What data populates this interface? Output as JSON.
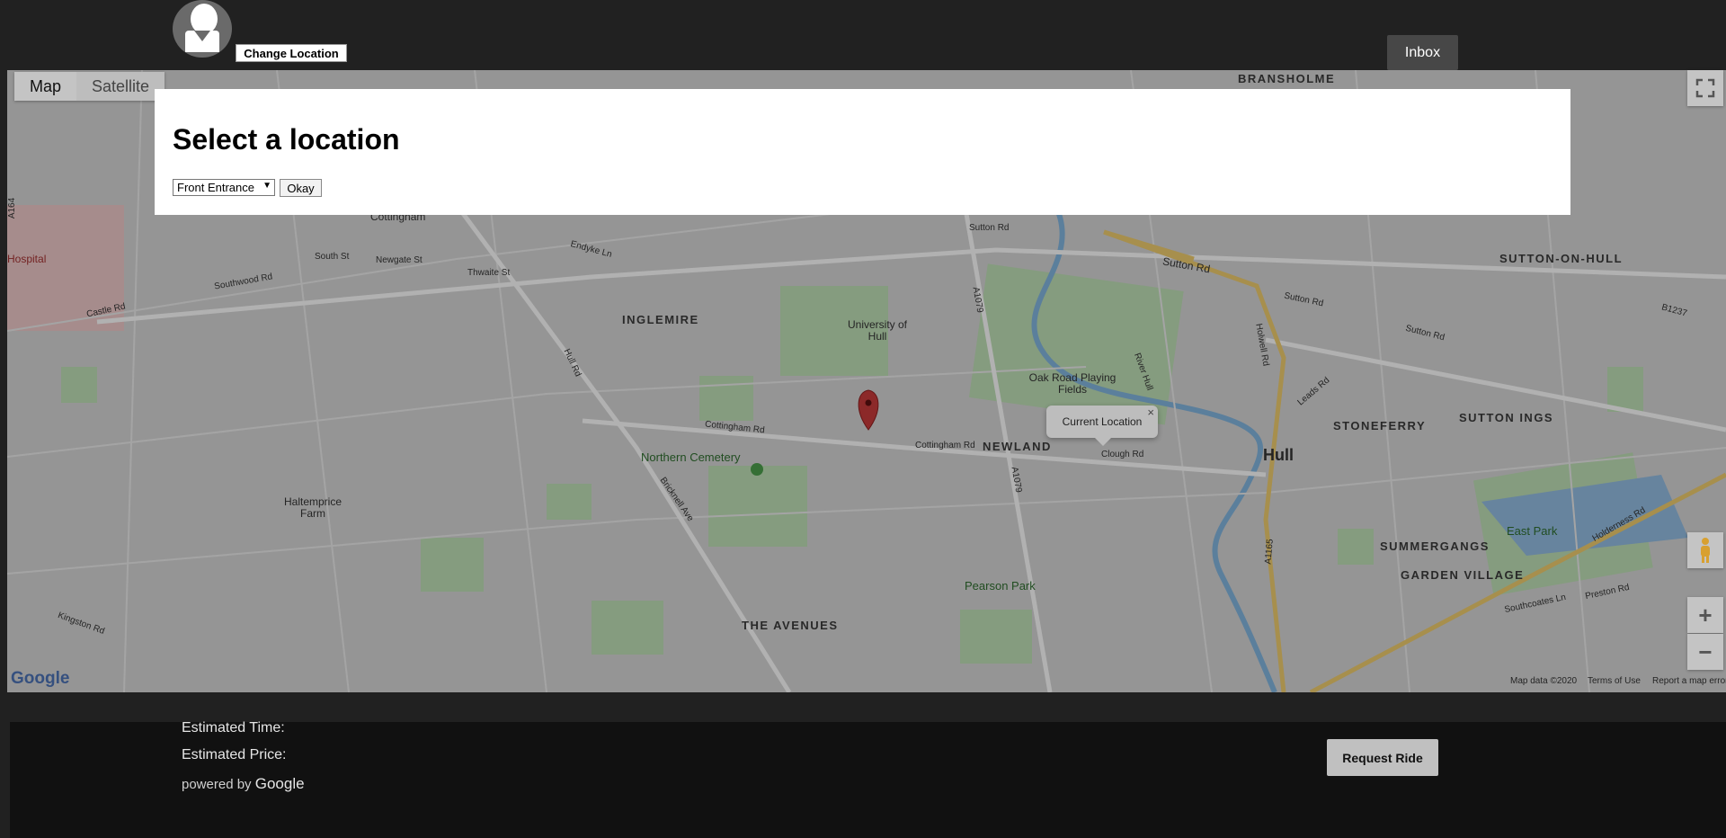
{
  "header": {
    "change_location_label": "Change Location",
    "inbox_label": "Inbox"
  },
  "map": {
    "type_buttons": [
      "Map",
      "Satellite"
    ],
    "labels": {
      "bransholme": "BRANSHOLME",
      "cottingham": "Cottingham",
      "hospital": "Hospital",
      "south_st": "South St",
      "newgate_st": "Newgate St",
      "thwaite_st": "Thwaite St",
      "endyke_ln": "Endyke Ln",
      "southwood_rd": "Southwood Rd",
      "castle_rd": "Castle Rd",
      "inglemire": "INGLEMIRE",
      "university": "University of Hull",
      "hull_rd": "Hull Rd",
      "a164": "A164",
      "sutton_rd_1": "Sutton Rd",
      "sutton_rd_2": "Sutton Rd",
      "sutton_rd_3": "Sutton Rd",
      "sutton_rd_4": "Sutton Rd",
      "sutton_on_hull": "SUTTON-ON-HULL",
      "oak_road": "Oak Road Playing Fields",
      "river_hull": "River Hull",
      "a1079_1": "A1079",
      "a1079_2": "A1079",
      "holwell_rd": "Holwell Rd",
      "leads_rd": "Leads Rd",
      "stoneferry": "STONEFERRY",
      "sutton_ings": "SUTTON INGS",
      "cottingham_rd_1": "Cottingham Rd",
      "cottingham_rd_2": "Cottingham Rd",
      "newland": "NEWLAND",
      "clough_rd": "Clough Rd",
      "hull": "Hull",
      "northern_cemetery": "Northern Cemetery",
      "bricknell_ave": "Bricknell Ave",
      "haltemprice_farm": "Haltemprice Farm",
      "a1165": "A1165",
      "summergangs": "SUMMERGANGS",
      "east_park": "East Park",
      "garden_village": "GARDEN VILLAGE",
      "holderness_rd": "Holderness Rd",
      "pearson_park": "Pearson Park",
      "the_avenues": "THE AVENUES",
      "kingston_rd": "Kingston Rd",
      "preston_rd": "Preston Rd",
      "southcoates_ln": "Southcoates Ln",
      "b1237": "B1237"
    },
    "info_bubble": "Current Location",
    "info_close": "×",
    "google_logo": "Google",
    "attribution": {
      "map_data": "Map data ©2020",
      "terms": "Terms of Use",
      "report": "Report a map error"
    },
    "zoom_in": "+",
    "zoom_out": "−"
  },
  "modal": {
    "title": "Select a location",
    "select_value": "Front Entrance",
    "okay_label": "Okay"
  },
  "footer": {
    "estimated_time_label": "Estimated Time:",
    "estimated_price_label": "Estimated Price:",
    "powered_by": "powered by",
    "powered_by_brand": "Google",
    "request_label": "Request Ride"
  }
}
